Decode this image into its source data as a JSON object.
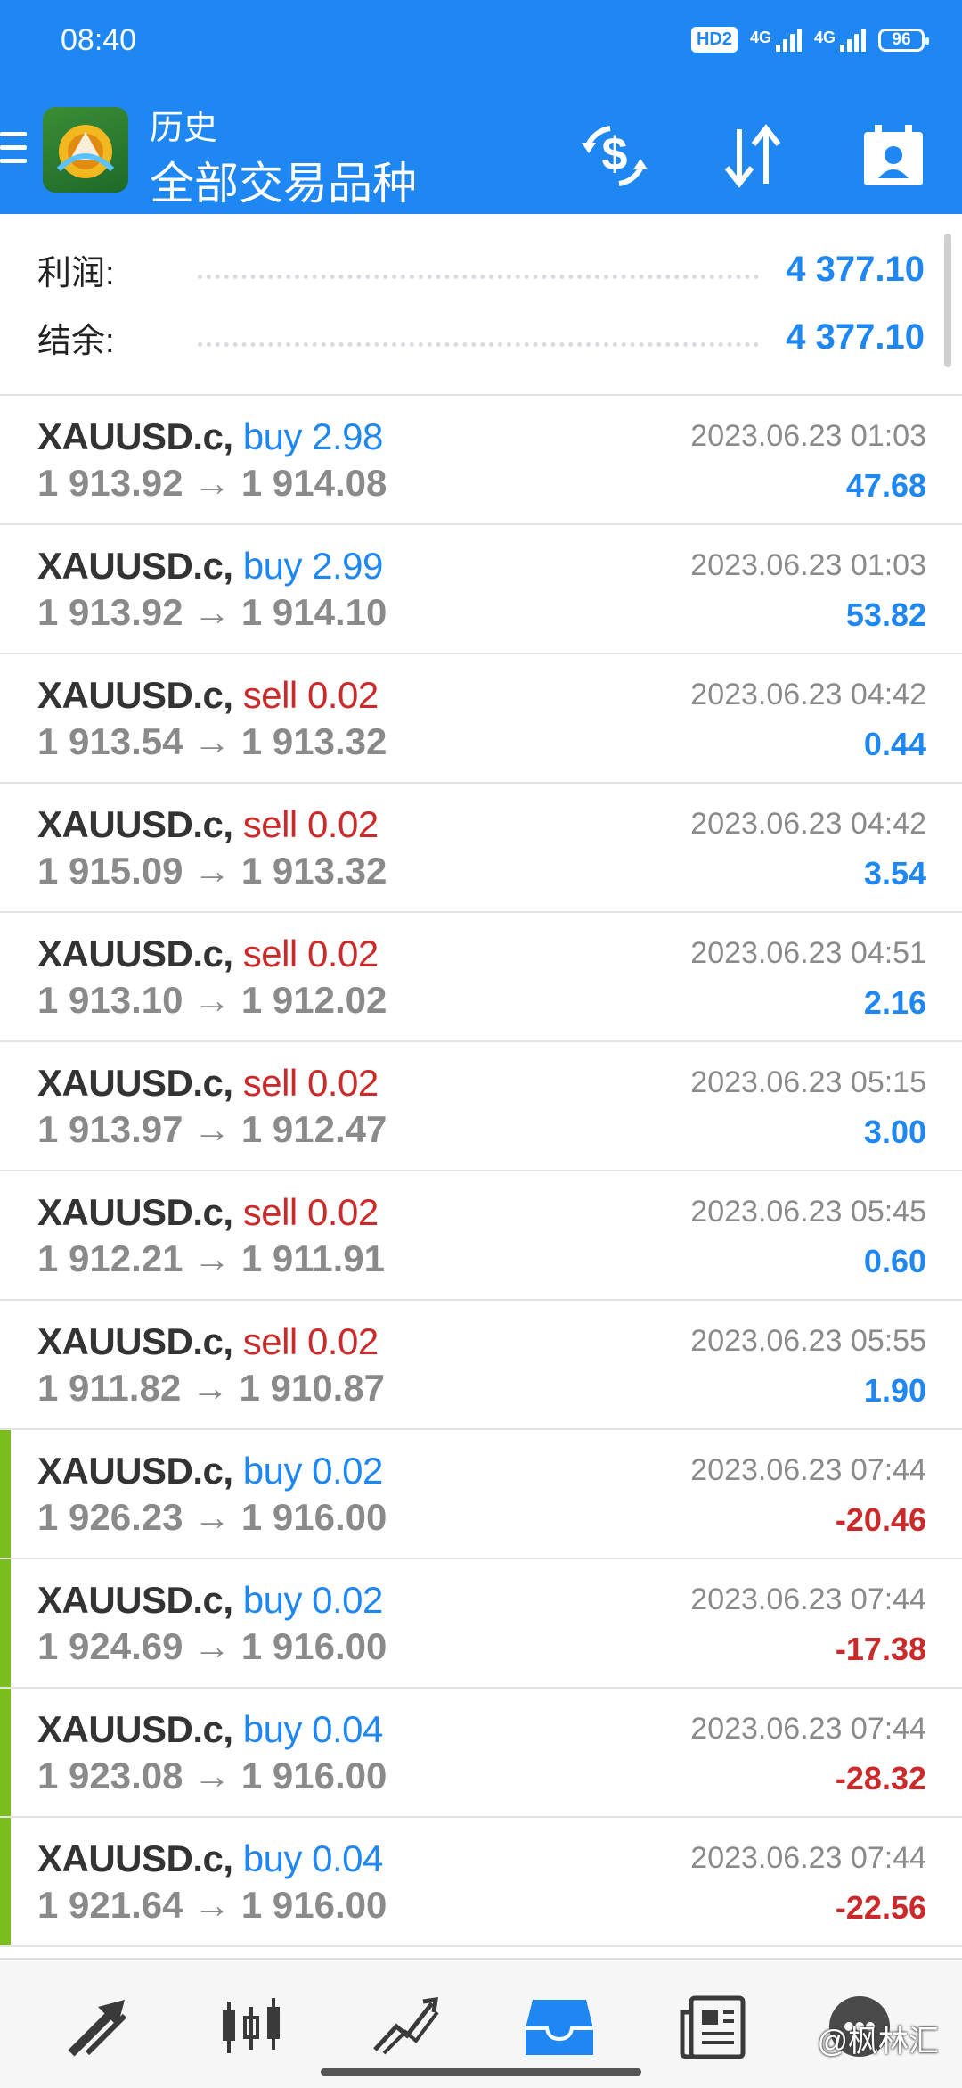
{
  "status_bar": {
    "time": "08:40",
    "hd_badge": "HD2",
    "network1": "4G",
    "network2": "4G",
    "battery": "96"
  },
  "header": {
    "subtitle": "历史",
    "title": "全部交易品种",
    "icons": [
      "menu-icon",
      "metatrader-logo",
      "dollar-refresh-icon",
      "sort-icon",
      "calendar-icon"
    ]
  },
  "summary": {
    "profit_label": "利润:",
    "profit_value": "4 377.10",
    "balance_label": "结余:",
    "balance_value": "4 377.10"
  },
  "trades": [
    {
      "symbol": "XAUUSD.c,",
      "type": "buy",
      "volume": "2.98",
      "open": "1 913.92",
      "close": "1 914.08",
      "time": "2023.06.23 01:03",
      "profit": "47.68"
    },
    {
      "symbol": "XAUUSD.c,",
      "type": "buy",
      "volume": "2.99",
      "open": "1 913.92",
      "close": "1 914.10",
      "time": "2023.06.23 01:03",
      "profit": "53.82"
    },
    {
      "symbol": "XAUUSD.c,",
      "type": "sell",
      "volume": "0.02",
      "open": "1 913.54",
      "close": "1 913.32",
      "time": "2023.06.23 04:42",
      "profit": "0.44"
    },
    {
      "symbol": "XAUUSD.c,",
      "type": "sell",
      "volume": "0.02",
      "open": "1 915.09",
      "close": "1 913.32",
      "time": "2023.06.23 04:42",
      "profit": "3.54"
    },
    {
      "symbol": "XAUUSD.c,",
      "type": "sell",
      "volume": "0.02",
      "open": "1 913.10",
      "close": "1 912.02",
      "time": "2023.06.23 04:51",
      "profit": "2.16"
    },
    {
      "symbol": "XAUUSD.c,",
      "type": "sell",
      "volume": "0.02",
      "open": "1 913.97",
      "close": "1 912.47",
      "time": "2023.06.23 05:15",
      "profit": "3.00"
    },
    {
      "symbol": "XAUUSD.c,",
      "type": "sell",
      "volume": "0.02",
      "open": "1 912.21",
      "close": "1 911.91",
      "time": "2023.06.23 05:45",
      "profit": "0.60"
    },
    {
      "symbol": "XAUUSD.c,",
      "type": "sell",
      "volume": "0.02",
      "open": "1 911.82",
      "close": "1 910.87",
      "time": "2023.06.23 05:55",
      "profit": "1.90"
    },
    {
      "symbol": "XAUUSD.c,",
      "type": "buy",
      "volume": "0.02",
      "open": "1 926.23",
      "close": "1 916.00",
      "time": "2023.06.23 07:44",
      "profit": "-20.46"
    },
    {
      "symbol": "XAUUSD.c,",
      "type": "buy",
      "volume": "0.02",
      "open": "1 924.69",
      "close": "1 916.00",
      "time": "2023.06.23 07:44",
      "profit": "-17.38"
    },
    {
      "symbol": "XAUUSD.c,",
      "type": "buy",
      "volume": "0.04",
      "open": "1 923.08",
      "close": "1 916.00",
      "time": "2023.06.23 07:44",
      "profit": "-28.32"
    },
    {
      "symbol": "XAUUSD.c,",
      "type": "buy",
      "volume": "0.04",
      "open": "1 921.64",
      "close": "1 916.00",
      "time": "2023.06.23 07:44",
      "profit": "-22.56"
    }
  ],
  "price_arrow": "→",
  "bottom_nav": {
    "items": [
      "quotes-icon",
      "chart-icon",
      "trade-icon",
      "history-icon",
      "news-icon",
      "chat-icon"
    ],
    "active": "history-icon"
  },
  "watermark": "@枫林汇",
  "colors": {
    "accent_blue": "#1f87f2",
    "sell_red": "#cc2a2a",
    "loss_marker_green": "#7cbd1e",
    "muted_gray": "#8a8a8a"
  }
}
